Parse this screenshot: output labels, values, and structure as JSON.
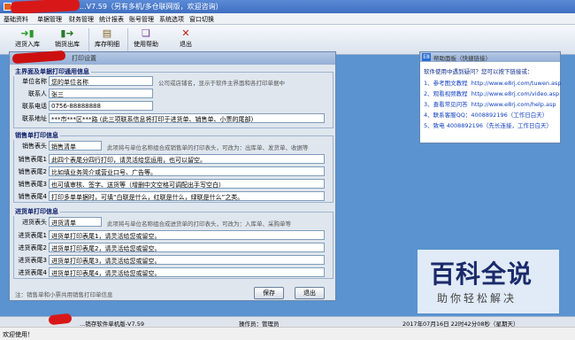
{
  "window": {
    "title": "...V7.59（另有多机/多仓联网版，欢迎咨询）"
  },
  "menu": [
    "基础资料",
    "单据管理",
    "财务管理",
    "统计报表",
    "账号管理",
    "系统选项",
    "窗口切换"
  ],
  "toolbar": [
    {
      "label": "进货入库",
      "icon": "inbox-icon"
    },
    {
      "label": "销货出库",
      "icon": "outbox-icon"
    },
    {
      "label": "库存明细",
      "icon": "inventory-icon"
    },
    {
      "label": "使用帮助",
      "icon": "help-book-icon"
    },
    {
      "label": "退出",
      "icon": "close-icon"
    }
  ],
  "dialog": {
    "title": "打印设置",
    "main_section": {
      "heading": "主界面及单据打印通用信息",
      "fields": [
        {
          "label": "单位名称",
          "value": "您的单位名称"
        },
        {
          "label": "联系人",
          "value": "张三"
        },
        {
          "label": "联系电话",
          "value": "0756-88888888"
        },
        {
          "label": "联系地址",
          "value": "***市***区***路  (此三项联系信息将打印于进货单、销售单、小票的尾部)"
        }
      ],
      "hint": "公司或店铺名，显示于软件主界面和各打印单据中"
    },
    "sales_section": {
      "heading": "销售单打印信息",
      "header_label": "销售表头",
      "header_value": "销售清单",
      "header_hint": "此项将与单位名称组合成销售单的打印表头，可改为：出库单、发货单、收据等",
      "rows": [
        {
          "label": "销售表尾1",
          "value": "此四个表尾分四行打印，请灵活给您运用，也可以留空。"
        },
        {
          "label": "销售表尾2",
          "value": "比如填业务简介或营业口号、广告等。"
        },
        {
          "label": "销售表尾3",
          "value": "也可填审核、签字、送货等（增删中文空格可调配出手写空白）"
        },
        {
          "label": "销售表尾4",
          "value": "打印多单单据时，可填“白联是什么，红联是什么，绿联是什么”之类。"
        }
      ]
    },
    "purchase_section": {
      "heading": "进货单打印信息",
      "header_label": "进货表头",
      "header_value": "进货清单",
      "header_hint": "此项将与单位名称组合成进货单的打印表头，可改为：入库单、采购单等",
      "rows": [
        {
          "label": "进货表尾1",
          "value": "进货单打印表尾1，请灵活给您或留空。"
        },
        {
          "label": "进货表尾2",
          "value": "进货单打印表尾2，请灵活给您或留空。"
        },
        {
          "label": "进货表尾3",
          "value": "进货单打印表尾3，请灵活给您或留空。"
        },
        {
          "label": "进货表尾4",
          "value": "进货单打印表尾4，请灵活给您或留空。"
        }
      ]
    },
    "note": "注：销售单和小票共用销售打印单信息",
    "save": "保存",
    "exit": "退出"
  },
  "help_panel": {
    "title": "帮助面板（快捷链接）",
    "intro": "软件使用中遇到疑问？您可以按下链接或：",
    "links": [
      {
        "num": "1、",
        "text": "参考图文教程",
        "url": "http://www.e8rj.com/tuwen.asp"
      },
      {
        "num": "2、",
        "text": "观看视频教程",
        "url": "http://www.e8rj.com/video.asp"
      },
      {
        "num": "3、",
        "text": "查看常见问答",
        "url": "http://www.e8rj.com/help.asp"
      }
    ],
    "qq": "4、联系客服QQ：4008892196（工作日白天）",
    "phone": "5、致电 4008892196（先长连接，工作日白天）"
  },
  "statusbar": {
    "app": "...销存软件单机版-V7.59",
    "operator": "操作员：管理员",
    "datetime": "2017年07月16日 22时42分08秒（星期天）"
  },
  "bottom_status": "欢迎使用！",
  "watermark": {
    "logo": "百科全说",
    "sub": "助你轻松解决"
  }
}
